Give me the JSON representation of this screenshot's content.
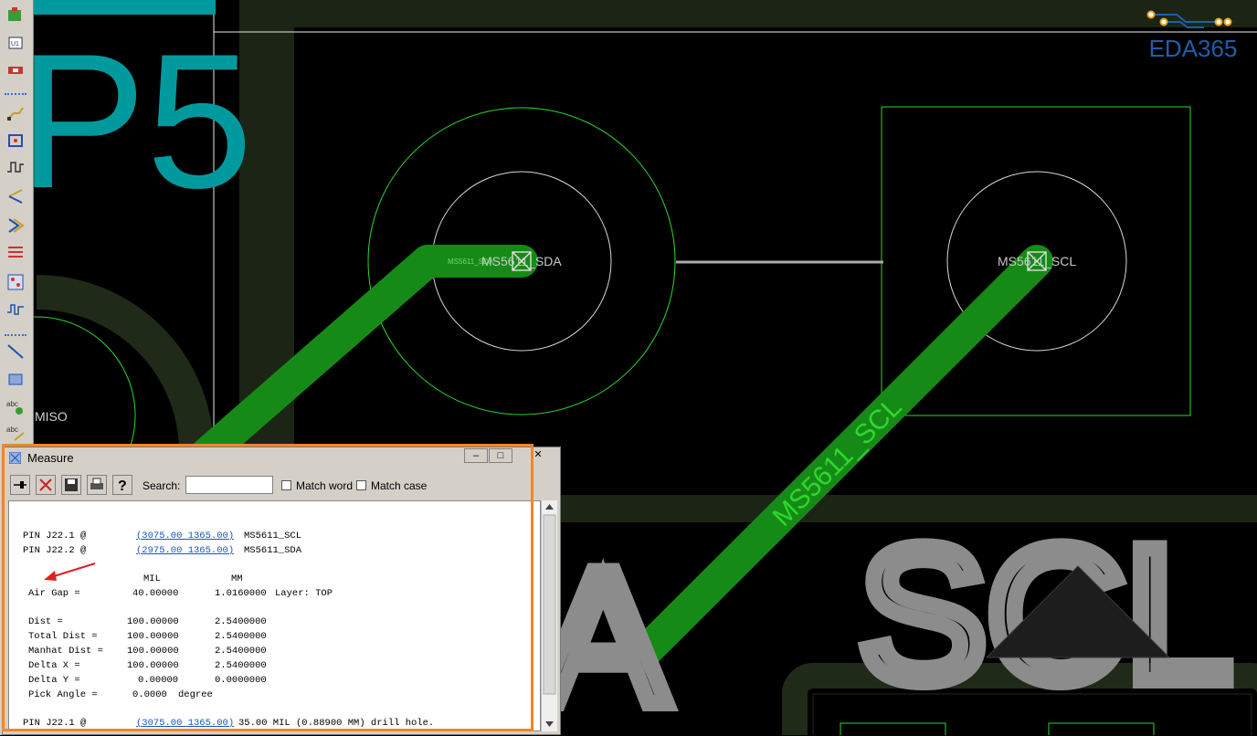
{
  "logo": {
    "text": "EDA365"
  },
  "pcb": {
    "pad_sda_label": "MS5611_SDA",
    "pad_sda_small_label": "MS5611_SDA",
    "pad_scl_label": "MS5611_SCL",
    "trace_label": "MS5611_SCL",
    "miso_label": "MISO",
    "big_text_p5": "P5",
    "big_text_scl": "SCL",
    "big_text_a": "A"
  },
  "toolbar": {
    "icons": [
      "component-icon",
      "u1-part-icon",
      "connector-icon",
      "route-icon",
      "pad-edit-icon",
      "waveform-icon",
      "fanout-icon",
      "arrow-route-icon",
      "list-icon",
      "grid-icon",
      "pulse-icon",
      "line-icon",
      "rectangle-icon",
      "text-add-icon",
      "text-edit-icon"
    ]
  },
  "measure": {
    "title": "Measure",
    "search_label": "Search:",
    "search_value": "",
    "match_word": "Match word",
    "match_case": "Match case",
    "pins": [
      {
        "label": "PIN J22.1 @",
        "coord": "(3075.00 1365.00)",
        "net": "MS5611_SCL"
      },
      {
        "label": "PIN J22.2 @",
        "coord": "(2975.00 1365.00)",
        "net": "MS5611_SDA"
      }
    ],
    "unit_headers": {
      "mil": "MIL",
      "mm": "MM"
    },
    "air_gap": {
      "label": "Air Gap =",
      "mil": "40.00000",
      "mm": "1.0160000",
      "layer": "Layer: TOP"
    },
    "rows": [
      {
        "label": "Dist =",
        "mil": "100.00000",
        "mm": "2.5400000"
      },
      {
        "label": "Total Dist =",
        "mil": "100.00000",
        "mm": "2.5400000"
      },
      {
        "label": "Manhat Dist =",
        "mil": "100.00000",
        "mm": "2.5400000"
      },
      {
        "label": "Delta X =",
        "mil": "100.00000",
        "mm": "2.5400000"
      },
      {
        "label": "Delta Y =",
        "mil": "0.00000",
        "mm": "0.0000000"
      }
    ],
    "pick_angle": {
      "label": "Pick Angle =",
      "value": "0.0000",
      "unit": "degree"
    },
    "drill": {
      "label": "PIN J22.1 @",
      "coord": "(3075.00 1365.00)",
      "text": "35.00 MIL (0.88900 MM) drill hole."
    }
  },
  "colors": {
    "trace": "#168a16",
    "outline": "#2ed82e",
    "silk": "#8c8c8c",
    "teal": "#009a9e",
    "highlight": "#f0862c"
  }
}
